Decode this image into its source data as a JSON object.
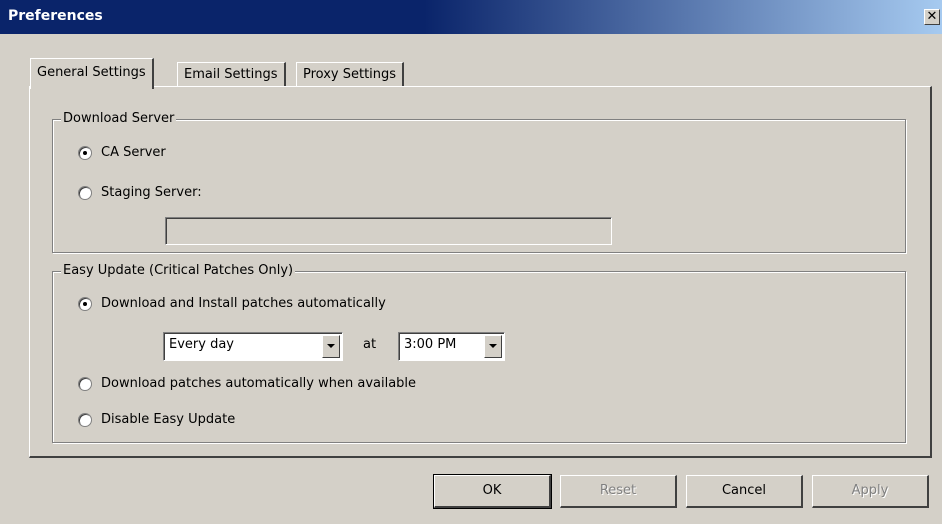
{
  "window": {
    "title": "Preferences",
    "close_label": "✕"
  },
  "tabs": [
    {
      "label": "General Settings",
      "active": true
    },
    {
      "label": "Email Settings",
      "active": false
    },
    {
      "label": "Proxy Settings",
      "active": false
    }
  ],
  "download_server": {
    "legend": "Download Server",
    "options": [
      {
        "label": "CA Server",
        "checked": true
      },
      {
        "label": "Staging Server:",
        "checked": false
      }
    ],
    "staging_value": ""
  },
  "easy_update": {
    "legend": "Easy Update (Critical Patches Only)",
    "options": [
      {
        "label": "Download and Install patches automatically",
        "checked": true
      },
      {
        "label": "Download patches automatically when available",
        "checked": false
      },
      {
        "label": "Disable Easy Update",
        "checked": false
      }
    ],
    "frequency": "Every day",
    "at_label": "at",
    "time": "3:00 PM"
  },
  "buttons": {
    "ok": "OK",
    "reset": "Reset",
    "cancel": "Cancel",
    "apply": "Apply"
  }
}
